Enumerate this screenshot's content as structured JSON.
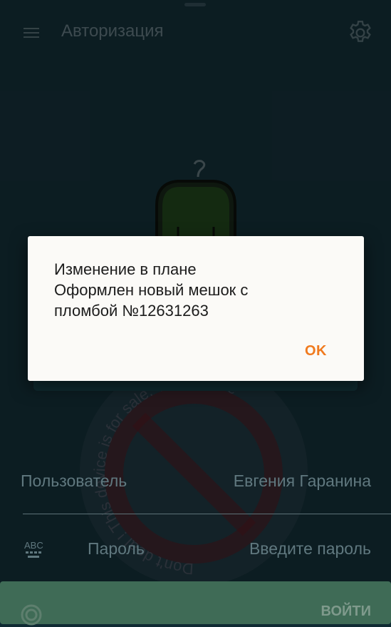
{
  "app_bar": {
    "title": "Авторизация",
    "menu_icon": "hamburger-menu-icon",
    "settings_icon": "gear-icon"
  },
  "illustration": {
    "icon": "bag-icon"
  },
  "dialog": {
    "message": "Изменение в плане\nОформлен новый мешок с\nпломбой №12631263",
    "ok_label": "OK",
    "accent_color": "#f07a1e"
  },
  "form": {
    "user_label": "Пользователь",
    "user_value": "Евгения Гаранина",
    "password_label": "Пароль",
    "password_placeholder": "Введите пароль",
    "keyboard_icon": "abc-keyboard-icon"
  },
  "login_button": {
    "label": "ВОЙТИ"
  },
  "watermark": {
    "text": "Don't deal ! This device is for sale. This device"
  }
}
